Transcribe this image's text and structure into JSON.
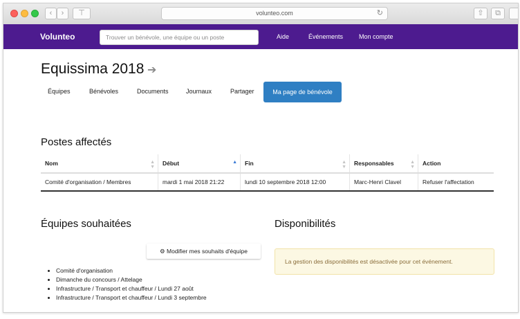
{
  "browser": {
    "url": "volunteo.com",
    "nav_back": "‹",
    "nav_forward": "›",
    "share_icon": "⊤",
    "reload_icon": "↻",
    "upload_icon": "⇧",
    "tabs_icon": "⧉"
  },
  "navbar": {
    "brand": "Volunteo",
    "search_placeholder": "Trouver un bénévole, une équipe ou un poste",
    "links": [
      "Aide",
      "Événements",
      "Mon compte"
    ],
    "color": "#4d1b8f"
  },
  "event": {
    "title": "Equissima 2018",
    "title_icon": "arrow-right-icon"
  },
  "tabs": [
    {
      "label": "Équipes"
    },
    {
      "label": "Bénévoles"
    },
    {
      "label": "Documents"
    },
    {
      "label": "Journaux"
    },
    {
      "label": "Partager"
    },
    {
      "label": "Ma page de bénévole",
      "active": true
    }
  ],
  "postes": {
    "heading": "Postes affectés",
    "columns": [
      "Nom",
      "Début",
      "Fin",
      "Responsables",
      "Action"
    ],
    "rows": [
      {
        "nom": "Comité d'organisation / Membres",
        "debut": "mardi 1 mai 2018 21:22",
        "fin": "lundi 10 septembre 2018 12:00",
        "responsables": "Marc-Henri Clavel",
        "action": "Refuser l'affectation"
      }
    ]
  },
  "equipes": {
    "heading": "Équipes souhaitées",
    "modify_button": "Modifier mes souhaits d'équipe",
    "items": [
      "Comité d'organisation",
      "Dimanche du concours / Attelage",
      "Infrastructure / Transport et chauffeur / Lundi 27 août",
      "Infrastructure / Transport et chauffeur / Lundi 3 septembre"
    ]
  },
  "disponibilites": {
    "heading": "Disponibilités",
    "alert": "La gestion des disponibilités est désactivée pour cet événement."
  }
}
